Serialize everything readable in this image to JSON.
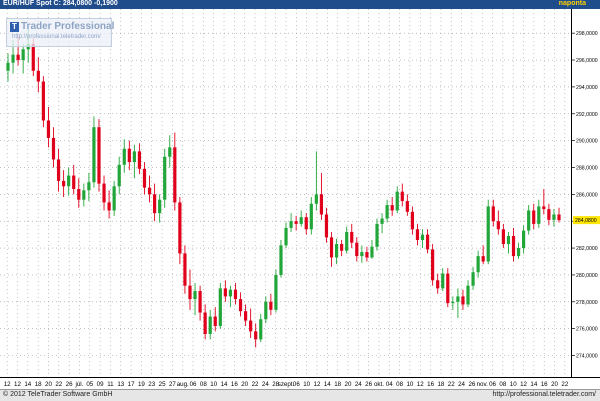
{
  "header": {
    "symbol_text": "EUR/HUF Spot C: 284,0800 -0,1900",
    "period": "naponta"
  },
  "watermark": {
    "name": "Trader Professional",
    "url": "http://professional.teletrader.com/"
  },
  "footer": {
    "copyright": "© 2012 TeleTrader Software GmbH",
    "url": "http://professional.teletrader.com/"
  },
  "colors": {
    "up": "#22a63a",
    "down": "#e0001b",
    "grid": "#9a9a9a",
    "last_price_bg": "#ffe600",
    "header_bg": "#1f4d8c"
  },
  "chart_data": {
    "type": "candlestick",
    "ylim": [
      272.4,
      299.8
    ],
    "yticks": [
      274,
      276,
      278,
      280,
      282,
      284,
      286,
      288,
      290,
      292,
      294,
      296,
      298
    ],
    "ytick_labels": [
      "274,0000",
      "276,0000",
      "278,0000",
      "280,0000",
      "282,0000",
      "284,0000",
      "286,0000",
      "288,0000",
      "290,0000",
      "292,0000",
      "294,0000",
      "296,0000",
      "298,0000"
    ],
    "last_price": 284.08,
    "last_price_label": "284,0800",
    "xtick_labels": [
      "12",
      "12",
      "14",
      "18",
      "20",
      "22",
      "26",
      "júl.",
      "05",
      "09",
      "11",
      "13",
      "17",
      "19",
      "23",
      "25",
      "27",
      "aug.",
      "06",
      "08",
      "10",
      "14",
      "16",
      "20",
      "22",
      "24",
      "28",
      "szept.",
      "06",
      "10",
      "12",
      "14",
      "18",
      "20",
      "24",
      "26",
      "okt.",
      "04",
      "08",
      "10",
      "12",
      "16",
      "18",
      "22",
      "24",
      "26",
      "nov.",
      "06",
      "08",
      "10",
      "12",
      "14",
      "16",
      "20",
      "22"
    ],
    "candles": [
      [
        295.2,
        296.5,
        294.4,
        295.8
      ],
      [
        295.8,
        297.5,
        295.0,
        296.4
      ],
      [
        296.4,
        297.8,
        295.6,
        296.0
      ],
      [
        296.0,
        297.2,
        295.0,
        296.8
      ],
      [
        296.8,
        298.5,
        295.8,
        297.2
      ],
      [
        297.2,
        297.6,
        294.8,
        295.2
      ],
      [
        295.2,
        296.2,
        293.6,
        294.4
      ],
      [
        294.4,
        294.8,
        291.0,
        291.5
      ],
      [
        291.5,
        292.5,
        289.5,
        290.2
      ],
      [
        290.2,
        291.0,
        288.0,
        288.6
      ],
      [
        288.6,
        289.4,
        286.2,
        287.0
      ],
      [
        287.0,
        287.8,
        285.8,
        286.6
      ],
      [
        286.6,
        288.0,
        285.9,
        287.4
      ],
      [
        287.4,
        288.2,
        286.0,
        286.4
      ],
      [
        286.4,
        287.2,
        285.0,
        285.6
      ],
      [
        285.6,
        286.8,
        285.1,
        286.3
      ],
      [
        286.3,
        287.6,
        285.5,
        286.9
      ],
      [
        286.9,
        291.8,
        286.5,
        291.0
      ],
      [
        291.0,
        291.6,
        286.2,
        286.8
      ],
      [
        286.8,
        287.4,
        284.8,
        285.4
      ],
      [
        285.4,
        286.3,
        284.2,
        284.8
      ],
      [
        284.8,
        287.0,
        284.4,
        286.6
      ],
      [
        286.6,
        288.8,
        286.0,
        288.2
      ],
      [
        288.2,
        290.1,
        287.6,
        289.4
      ],
      [
        289.4,
        290.0,
        287.8,
        288.4
      ],
      [
        288.4,
        289.7,
        287.2,
        289.2
      ],
      [
        289.2,
        289.8,
        287.5,
        287.9
      ],
      [
        287.9,
        288.4,
        286.0,
        286.5
      ],
      [
        286.5,
        287.4,
        285.4,
        286.0
      ],
      [
        286.0,
        286.8,
        284.0,
        284.6
      ],
      [
        284.6,
        286.0,
        283.9,
        285.6
      ],
      [
        285.6,
        289.4,
        285.0,
        288.8
      ],
      [
        288.8,
        290.4,
        288.0,
        289.5
      ],
      [
        289.5,
        290.6,
        284.8,
        285.4
      ],
      [
        285.4,
        285.8,
        280.8,
        281.6
      ],
      [
        281.6,
        282.2,
        278.6,
        279.2
      ],
      [
        279.2,
        280.4,
        277.4,
        278.2
      ],
      [
        278.2,
        279.4,
        277.0,
        278.8
      ],
      [
        278.8,
        279.2,
        276.6,
        277.2
      ],
      [
        277.2,
        277.8,
        275.2,
        275.6
      ],
      [
        275.6,
        277.4,
        275.2,
        276.9
      ],
      [
        276.9,
        277.6,
        275.8,
        276.2
      ],
      [
        276.2,
        279.4,
        276.0,
        279.0
      ],
      [
        279.0,
        279.6,
        278.0,
        278.4
      ],
      [
        278.4,
        279.2,
        277.6,
        278.9
      ],
      [
        278.9,
        279.4,
        277.8,
        278.2
      ],
      [
        278.2,
        278.7,
        276.9,
        277.3
      ],
      [
        277.3,
        277.8,
        276.2,
        276.6
      ],
      [
        276.6,
        277.5,
        275.3,
        275.8
      ],
      [
        275.8,
        276.4,
        274.6,
        275.2
      ],
      [
        275.2,
        277.1,
        275.0,
        276.7
      ],
      [
        276.7,
        278.4,
        276.4,
        278.0
      ],
      [
        278.0,
        278.6,
        277.0,
        277.4
      ],
      [
        277.4,
        280.4,
        277.2,
        280.0
      ],
      [
        280.0,
        282.6,
        279.8,
        282.2
      ],
      [
        282.2,
        283.9,
        282.0,
        283.5
      ],
      [
        283.5,
        284.6,
        283.2,
        284.0
      ],
      [
        284.0,
        284.4,
        283.3,
        283.8
      ],
      [
        283.8,
        284.8,
        283.6,
        284.3
      ],
      [
        284.3,
        284.6,
        283.0,
        283.4
      ],
      [
        283.4,
        285.8,
        283.0,
        285.3
      ],
      [
        285.3,
        289.2,
        284.8,
        286.0
      ],
      [
        286.0,
        287.6,
        284.1,
        284.5
      ],
      [
        284.5,
        285.0,
        282.4,
        282.8
      ],
      [
        282.8,
        283.2,
        280.6,
        281.3
      ],
      [
        281.3,
        282.7,
        280.8,
        282.3
      ],
      [
        282.3,
        282.6,
        281.4,
        281.8
      ],
      [
        281.8,
        283.6,
        281.6,
        283.2
      ],
      [
        283.2,
        283.8,
        282.0,
        282.4
      ],
      [
        282.4,
        282.8,
        281.0,
        281.4
      ],
      [
        281.4,
        282.2,
        280.9,
        281.7
      ],
      [
        281.7,
        282.1,
        281.0,
        281.3
      ],
      [
        281.3,
        282.6,
        281.2,
        282.1
      ],
      [
        282.1,
        284.2,
        281.8,
        283.8
      ],
      [
        283.8,
        284.6,
        283.1,
        284.2
      ],
      [
        284.2,
        285.6,
        283.9,
        285.2
      ],
      [
        285.2,
        285.8,
        284.4,
        284.8
      ],
      [
        284.8,
        286.6,
        284.6,
        286.2
      ],
      [
        286.2,
        286.8,
        285.1,
        285.5
      ],
      [
        285.5,
        286.0,
        284.4,
        284.7
      ],
      [
        284.7,
        285.1,
        283.0,
        283.4
      ],
      [
        283.4,
        283.8,
        282.2,
        282.6
      ],
      [
        282.6,
        283.4,
        282.0,
        283.0
      ],
      [
        283.0,
        283.4,
        281.6,
        281.9
      ],
      [
        281.9,
        282.3,
        279.2,
        279.6
      ],
      [
        279.6,
        280.1,
        278.6,
        279.0
      ],
      [
        279.0,
        280.5,
        278.8,
        280.1
      ],
      [
        280.1,
        280.5,
        277.6,
        277.9
      ],
      [
        277.9,
        278.4,
        277.4,
        278.0
      ],
      [
        278.0,
        279.0,
        276.8,
        278.4
      ],
      [
        278.4,
        278.9,
        277.4,
        277.8
      ],
      [
        277.8,
        279.6,
        277.6,
        279.2
      ],
      [
        279.2,
        280.6,
        278.9,
        280.2
      ],
      [
        280.2,
        281.8,
        279.8,
        281.4
      ],
      [
        281.4,
        282.2,
        280.8,
        281.0
      ],
      [
        281.0,
        285.6,
        280.8,
        285.1
      ],
      [
        285.1,
        285.6,
        283.6,
        284.0
      ],
      [
        284.0,
        284.8,
        283.0,
        283.4
      ],
      [
        283.4,
        283.8,
        282.0,
        282.3
      ],
      [
        282.3,
        283.2,
        281.6,
        282.9
      ],
      [
        282.9,
        283.5,
        281.0,
        281.4
      ],
      [
        281.4,
        282.4,
        281.2,
        282.0
      ],
      [
        282.0,
        283.7,
        281.6,
        283.3
      ],
      [
        283.3,
        285.2,
        283.0,
        284.8
      ],
      [
        284.8,
        285.3,
        283.4,
        283.8
      ],
      [
        283.8,
        285.6,
        283.5,
        285.1
      ],
      [
        285.1,
        286.4,
        284.5,
        284.9
      ],
      [
        284.9,
        285.3,
        283.7,
        284.1
      ],
      [
        284.1,
        284.9,
        283.6,
        284.5
      ],
      [
        284.5,
        285.0,
        283.9,
        284.08
      ]
    ]
  }
}
